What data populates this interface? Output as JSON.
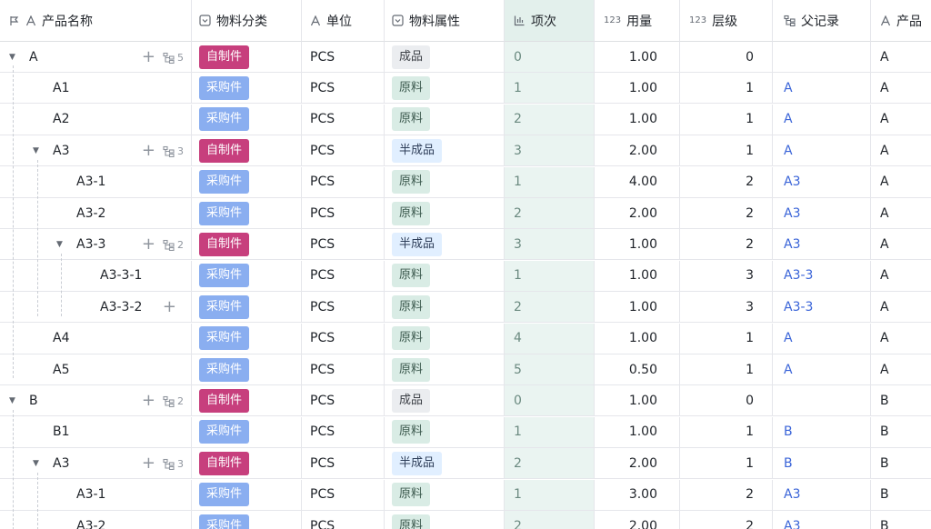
{
  "columns": {
    "name": "产品名称",
    "category": "物料分类",
    "unit": "单位",
    "attr": "物料属性",
    "seq": "项次",
    "qty": "用量",
    "level": "层级",
    "parent": "父记录",
    "product": "产品"
  },
  "icons": {
    "name_col": "flag-and-text-icon",
    "text_col": "text-type-icon",
    "select_col": "single-select-icon",
    "seq_col": "bar-chart-icon",
    "number_col": "123",
    "link_col": "hierarchy-link-icon"
  },
  "colors": {
    "self_made": "#c73f7d",
    "purchased": "#8aaef0",
    "seq_column_bg": "#eaf4f1",
    "link_text": "#3a64d8"
  },
  "rows": [
    {
      "name": "A",
      "indent": 0,
      "expand": true,
      "add": true,
      "children": "5",
      "category": "自制件",
      "unit": "PCS",
      "attr": "成品",
      "seq": "0",
      "qty": "1.00",
      "level": "0",
      "parent": "",
      "product": "A"
    },
    {
      "name": "A1",
      "indent": 1,
      "expand": false,
      "add": false,
      "children": "",
      "category": "采购件",
      "unit": "PCS",
      "attr": "原料",
      "seq": "1",
      "qty": "1.00",
      "level": "1",
      "parent": "A",
      "product": "A"
    },
    {
      "name": "A2",
      "indent": 1,
      "expand": false,
      "add": false,
      "children": "",
      "category": "采购件",
      "unit": "PCS",
      "attr": "原料",
      "seq": "2",
      "qty": "1.00",
      "level": "1",
      "parent": "A",
      "product": "A"
    },
    {
      "name": "A3",
      "indent": 1,
      "expand": true,
      "add": true,
      "children": "3",
      "category": "自制件",
      "unit": "PCS",
      "attr": "半成品",
      "seq": "3",
      "qty": "2.00",
      "level": "1",
      "parent": "A",
      "product": "A"
    },
    {
      "name": "A3-1",
      "indent": 2,
      "expand": false,
      "add": false,
      "children": "",
      "category": "采购件",
      "unit": "PCS",
      "attr": "原料",
      "seq": "1",
      "qty": "4.00",
      "level": "2",
      "parent": "A3",
      "product": "A"
    },
    {
      "name": "A3-2",
      "indent": 2,
      "expand": false,
      "add": false,
      "children": "",
      "category": "采购件",
      "unit": "PCS",
      "attr": "原料",
      "seq": "2",
      "qty": "2.00",
      "level": "2",
      "parent": "A3",
      "product": "A"
    },
    {
      "name": "A3-3",
      "indent": 2,
      "expand": true,
      "add": true,
      "children": "2",
      "category": "自制件",
      "unit": "PCS",
      "attr": "半成品",
      "seq": "3",
      "qty": "1.00",
      "level": "2",
      "parent": "A3",
      "product": "A"
    },
    {
      "name": "A3-3-1",
      "indent": 3,
      "expand": false,
      "add": false,
      "children": "",
      "category": "采购件",
      "unit": "PCS",
      "attr": "原料",
      "seq": "1",
      "qty": "1.00",
      "level": "3",
      "parent": "A3-3",
      "product": "A"
    },
    {
      "name": "A3-3-2",
      "indent": 3,
      "expand": false,
      "add": true,
      "children": "",
      "category": "采购件",
      "unit": "PCS",
      "attr": "原料",
      "seq": "2",
      "qty": "1.00",
      "level": "3",
      "parent": "A3-3",
      "product": "A"
    },
    {
      "name": "A4",
      "indent": 1,
      "expand": false,
      "add": false,
      "children": "",
      "category": "采购件",
      "unit": "PCS",
      "attr": "原料",
      "seq": "4",
      "qty": "1.00",
      "level": "1",
      "parent": "A",
      "product": "A"
    },
    {
      "name": "A5",
      "indent": 1,
      "expand": false,
      "add": false,
      "children": "",
      "category": "采购件",
      "unit": "PCS",
      "attr": "原料",
      "seq": "5",
      "qty": "0.50",
      "level": "1",
      "parent": "A",
      "product": "A"
    },
    {
      "name": "B",
      "indent": 0,
      "expand": true,
      "add": true,
      "children": "2",
      "category": "自制件",
      "unit": "PCS",
      "attr": "成品",
      "seq": "0",
      "qty": "1.00",
      "level": "0",
      "parent": "",
      "product": "B"
    },
    {
      "name": "B1",
      "indent": 1,
      "expand": false,
      "add": false,
      "children": "",
      "category": "采购件",
      "unit": "PCS",
      "attr": "原料",
      "seq": "1",
      "qty": "1.00",
      "level": "1",
      "parent": "B",
      "product": "B"
    },
    {
      "name": "A3",
      "indent": 1,
      "expand": true,
      "add": true,
      "children": "3",
      "category": "自制件",
      "unit": "PCS",
      "attr": "半成品",
      "seq": "2",
      "qty": "2.00",
      "level": "1",
      "parent": "B",
      "product": "B"
    },
    {
      "name": "A3-1",
      "indent": 2,
      "expand": false,
      "add": false,
      "children": "",
      "category": "采购件",
      "unit": "PCS",
      "attr": "原料",
      "seq": "1",
      "qty": "3.00",
      "level": "2",
      "parent": "A3",
      "product": "B"
    },
    {
      "name": "A3-2",
      "indent": 2,
      "expand": false,
      "add": false,
      "children": "",
      "category": "采购件",
      "unit": "PCS",
      "attr": "原料",
      "seq": "2",
      "qty": "2.00",
      "level": "2",
      "parent": "A3",
      "product": "B"
    }
  ]
}
